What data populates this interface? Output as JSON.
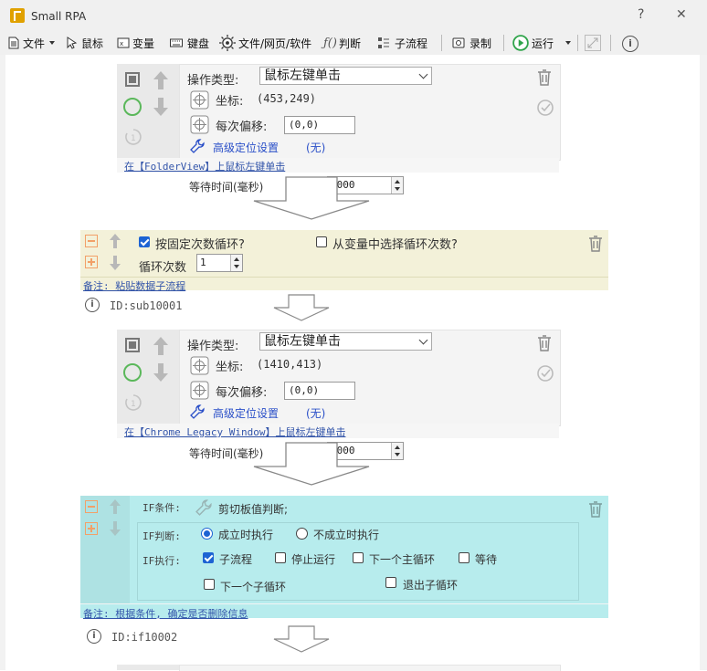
{
  "window": {
    "title": "Small RPA",
    "help": "?",
    "close": "✕"
  },
  "toolbar": {
    "file": "文件",
    "mouse": "鼠标",
    "variable": "变量",
    "keyboard": "键盘",
    "web_software": "文件/网页/软件",
    "condition": "判断",
    "subflow": "子流程",
    "record": "录制",
    "run": "运行"
  },
  "step1": {
    "op_label": "操作类型:",
    "op_value": "鼠标左键单击",
    "coord_label": "坐标:",
    "coord_value": "(453,249)",
    "offset_label": "每次偏移:",
    "offset_value": "(0,0)",
    "advanced": "高级定位设置",
    "advanced_state": "(无)",
    "desc": "在【FolderView】上鼠标左键单击",
    "wait_label": "等待时间(毫秒)",
    "wait_value": "1000"
  },
  "loop": {
    "fixed_label": "按固定次数循环?",
    "fixed_checked": true,
    "from_var_label": "从变量中选择循环次数?",
    "from_var_checked": false,
    "count_label": "循环次数",
    "count_value": "1",
    "note": "备注: 粘贴数据子流程",
    "id": "ID:sub10001"
  },
  "step2": {
    "op_label": "操作类型:",
    "op_value": "鼠标左键单击",
    "coord_label": "坐标:",
    "coord_value": "(1410,413)",
    "offset_label": "每次偏移:",
    "offset_value": "(0,0)",
    "advanced": "高级定位设置",
    "advanced_state": "(无)",
    "desc": "在【Chrome Legacy Window】上鼠标左键单击",
    "wait_label": "等待时间(毫秒)",
    "wait_value": "1000"
  },
  "ifblock": {
    "cond_label": "IF条件:",
    "cond_value": "剪切板值判断;",
    "judge_label": "IF判断:",
    "judge_true": "成立时执行",
    "judge_false": "不成立时执行",
    "exec_label": "IF执行:",
    "opt_subflow": "子流程",
    "opt_stop": "停止运行",
    "opt_next_main": "下一个主循环",
    "opt_wait": "等待",
    "opt_next_sub": "下一个子循环",
    "opt_exit_sub": "退出子循环",
    "note": "备注: 根据条件, 确定是否删除信息",
    "id": "ID:if10002"
  },
  "colors": {
    "loop_bg": "#f3f1d9",
    "if_bg": "#b7eced",
    "accent": "#1d63d3",
    "link": "#3355aa"
  }
}
